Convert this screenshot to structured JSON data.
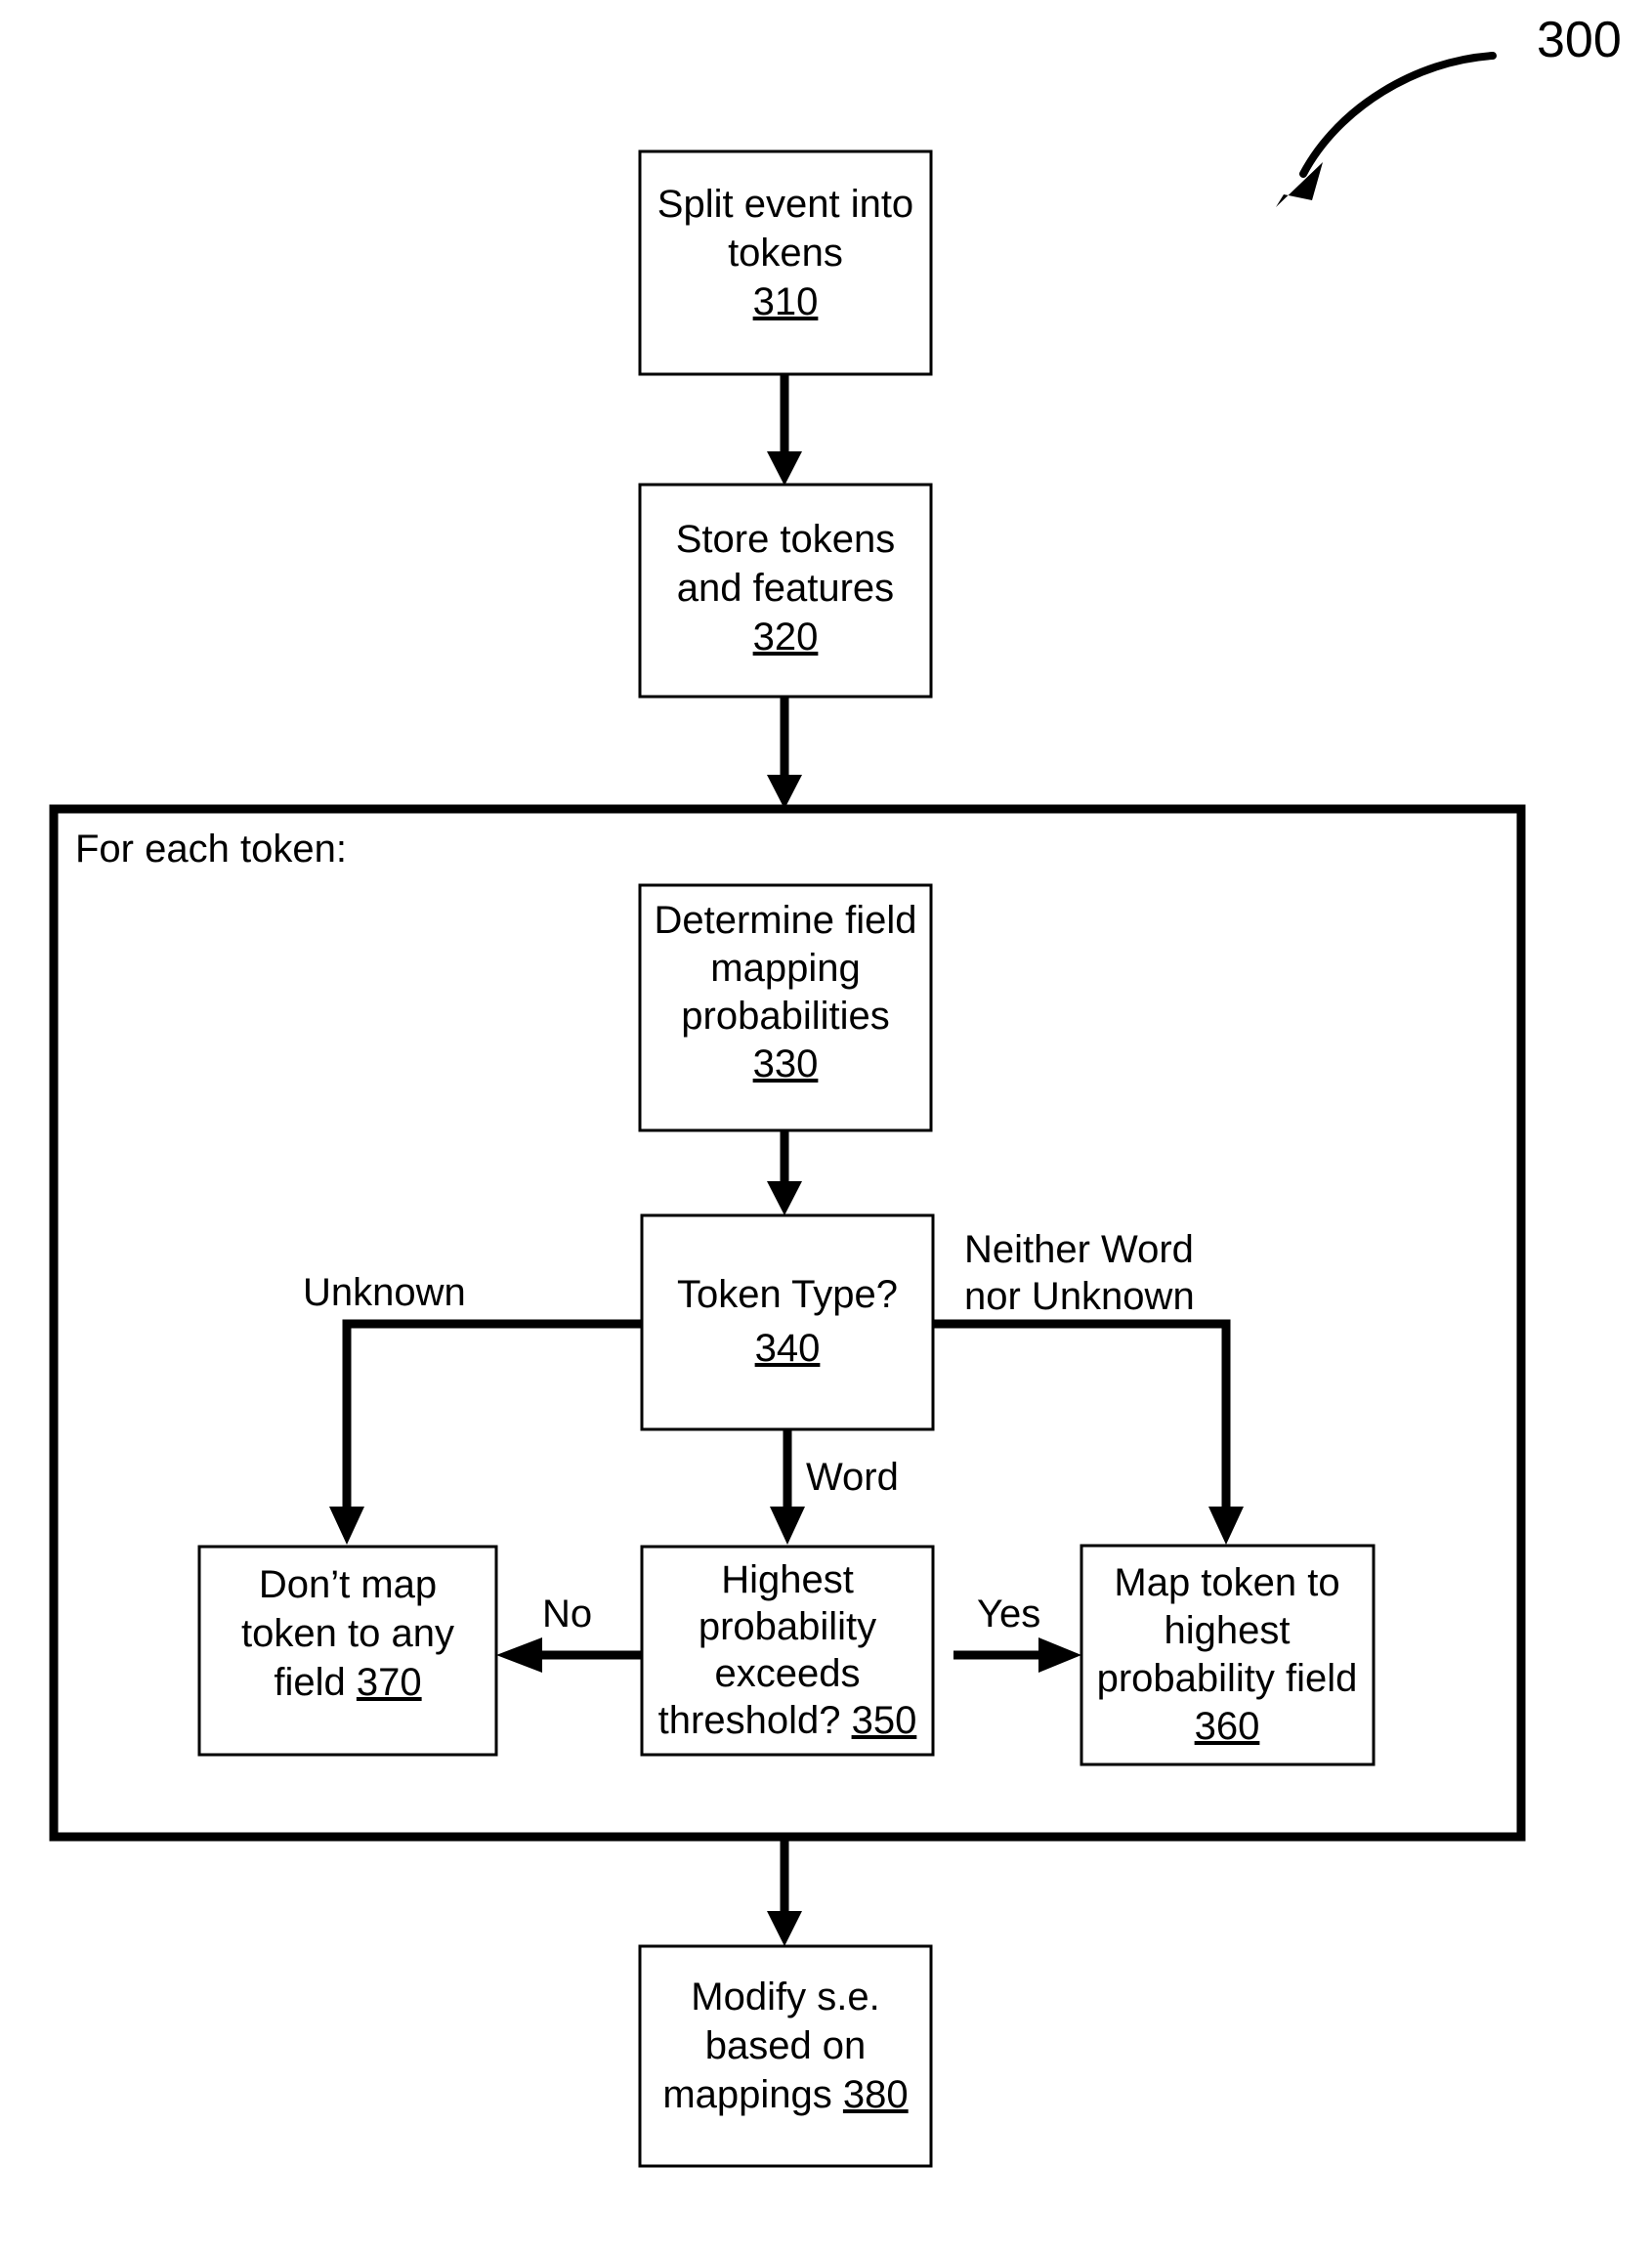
{
  "figure": {
    "number": "300",
    "type": "patent-flowchart"
  },
  "container": {
    "label": "For each token:"
  },
  "nodes": {
    "n310": {
      "lines": [
        "Split event into",
        "tokens"
      ],
      "ref": "310"
    },
    "n320": {
      "lines": [
        "Store tokens",
        "and features"
      ],
      "ref": "320"
    },
    "n330": {
      "lines": [
        "Determine field",
        "mapping",
        "probabilities"
      ],
      "ref": "330"
    },
    "n340": {
      "lines": [
        "Token Type?"
      ],
      "ref": "340"
    },
    "n350": {
      "lines": [
        "Highest",
        "probability",
        "exceeds"
      ],
      "last_line_text": "threshold? ",
      "ref": "350"
    },
    "n360": {
      "lines": [
        "Map token to",
        "highest",
        "probability field"
      ],
      "ref": "360"
    },
    "n370": {
      "lines": [
        "Don’t map",
        "token to any"
      ],
      "last_line_text": "field ",
      "ref": "370"
    },
    "n380": {
      "lines": [
        "Modify s.e.",
        "based on"
      ],
      "last_line_text": "mappings ",
      "ref": "380"
    }
  },
  "edge_labels": {
    "unknown": "Unknown",
    "neither_word_nor_unknown_line1": "Neither Word",
    "neither_word_nor_unknown_line2": "nor Unknown",
    "word": "Word",
    "no": "No",
    "yes": "Yes"
  },
  "colors": {
    "stroke": "#000000",
    "fill": "#ffffff",
    "text": "#000000"
  }
}
